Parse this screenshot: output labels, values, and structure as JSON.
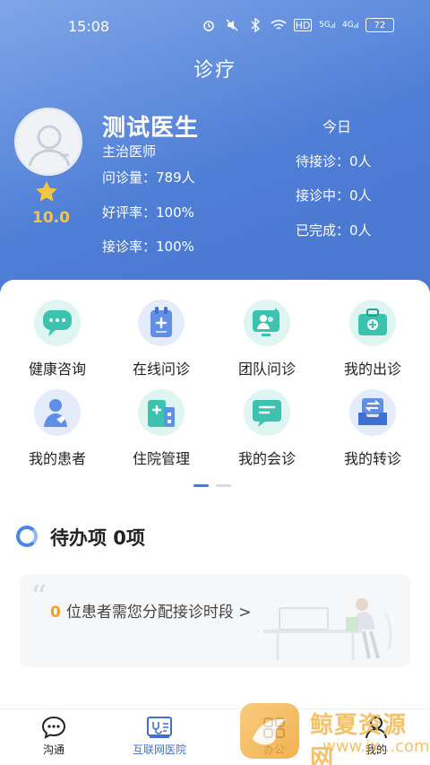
{
  "status_bar": {
    "time": "15:08",
    "battery": "72",
    "network_badge": "HD",
    "signal1": "5G",
    "signal2": "4G"
  },
  "header": {
    "title": "诊疗"
  },
  "doctor": {
    "name": "测试医生",
    "title": "主治医师",
    "stats": [
      "问诊量：789人",
      "好评率：100%",
      "接诊率：100%"
    ],
    "rating": "10.0"
  },
  "today": {
    "title": "今日",
    "rows": [
      "待接诊：0人",
      "接诊中：0人",
      "已完成：0人"
    ]
  },
  "grid": {
    "items": [
      {
        "label": "健康咨询",
        "icon": "chat-bubble-icon"
      },
      {
        "label": "在线问诊",
        "icon": "clipboard-icon"
      },
      {
        "label": "团队问诊",
        "icon": "team-icon"
      },
      {
        "label": "我的出诊",
        "icon": "medical-kit-icon"
      },
      {
        "label": "我的患者",
        "icon": "patients-icon"
      },
      {
        "label": "住院管理",
        "icon": "hospital-icon"
      },
      {
        "label": "我的会诊",
        "icon": "consultation-icon"
      },
      {
        "label": "我的转诊",
        "icon": "transfer-icon"
      }
    ]
  },
  "pager": {
    "pages": 2,
    "active": 1
  },
  "todo": {
    "title": "待办项 0项",
    "count": "0",
    "message": "位患者需您分配接诊时段 >"
  },
  "tabbar": {
    "tabs": [
      {
        "label": "沟通",
        "icon": "chat-icon"
      },
      {
        "label": "互联网医院",
        "icon": "stethoscope-icon"
      },
      {
        "label": "办公",
        "icon": "office-icon"
      },
      {
        "label": "我的",
        "icon": "profile-icon"
      }
    ],
    "active_tab": "互联网医院"
  },
  "watermark": {
    "text": "鲸夏资源网",
    "url": "www.jx...com"
  },
  "colors": {
    "header_start": "#7fa6e8",
    "header_end": "#4a76cf",
    "accent": "#4d79cf",
    "rating": "#f4c542",
    "todo_count": "#f0a020"
  }
}
